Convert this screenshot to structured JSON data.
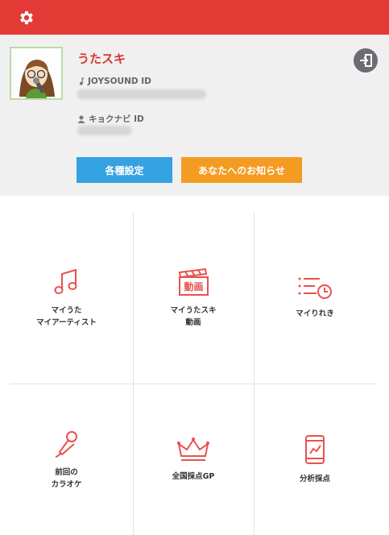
{
  "header": {
    "settings_icon": "gear-icon",
    "background": "#e43a36"
  },
  "profile": {
    "username": "うたスキ",
    "joysound_label": "JOYSOUND ID",
    "kyokunavi_label": "キョクナビ ID",
    "logout_icon": "logout-icon",
    "buttons": {
      "settings": "各種設定",
      "notifications": "あなたへのお知らせ"
    }
  },
  "menu": [
    {
      "id": "my-uta",
      "icon": "music-note-icon",
      "line1": "マイうた",
      "line2": "マイアーティスト"
    },
    {
      "id": "my-uta-video",
      "icon": "video-clapper-icon",
      "line1": "マイうたスキ",
      "line2": "動画",
      "icon_text": "動画"
    },
    {
      "id": "my-history",
      "icon": "history-list-icon",
      "line1": "マイりれき",
      "line2": ""
    },
    {
      "id": "last-karaoke",
      "icon": "microphone-icon",
      "line1": "前回の",
      "line2": "カラオケ"
    },
    {
      "id": "national-scoring",
      "icon": "crown-icon",
      "line1": "全国採点GP",
      "line2": ""
    },
    {
      "id": "analysis-scoring",
      "icon": "smartphone-chart-icon",
      "line1": "分析採点",
      "line2": ""
    }
  ],
  "colors": {
    "accent": "#e43a36",
    "icon": "#e8524e",
    "blue": "#34a2e0",
    "orange": "#f49b21"
  }
}
